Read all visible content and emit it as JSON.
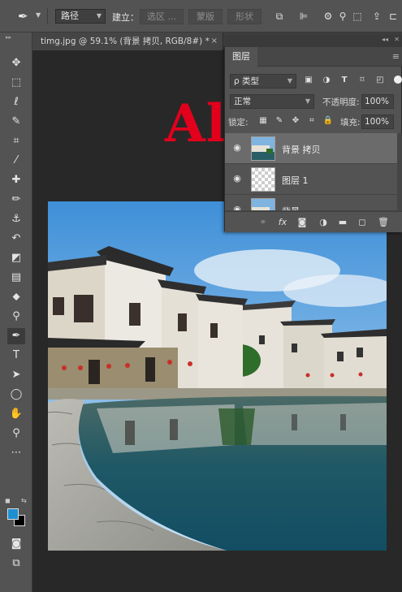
{
  "options_bar": {
    "mode_value": "路径",
    "make_label": "建立：",
    "selection_btn": "选区 ...",
    "mask_btn": "蒙版",
    "shape_btn": "形状"
  },
  "document": {
    "tab_title": "timg.jpg @ 59.1% (背景 拷贝, RGB/8#) *",
    "close_glyph": "×"
  },
  "overlay": {
    "alt_text": "Alt"
  },
  "layers_panel": {
    "tab_label": "图层",
    "filter_kind": "ρ 类型",
    "blend_mode": "正常",
    "opacity_label": "不透明度:",
    "opacity_value": "100%",
    "lock_label": "锁定:",
    "fill_label": "填充:",
    "fill_value": "100%",
    "layers": [
      {
        "name": "背景 拷贝",
        "selected": true
      },
      {
        "name": "图层 1",
        "selected": false
      },
      {
        "name": "背景",
        "selected": false
      }
    ]
  },
  "colors": {
    "foreground": "#1e8fd0",
    "background": "#000000",
    "alt_text": "#e3001c"
  }
}
